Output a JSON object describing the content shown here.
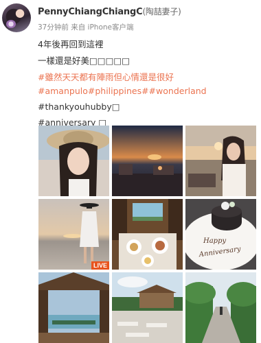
{
  "post": {
    "username": "PennyChiangChiangC",
    "remark": "(陶喆妻子)",
    "time": "37分钟前",
    "source": "来自 iPhone客户端",
    "lines": [
      {
        "text": "4年後再回到這裡",
        "style": "plain"
      },
      {
        "text": "一樣還是好美□□□□□",
        "style": "plain"
      },
      {
        "text": "#雖然天天都有陣雨但心情還是很好",
        "style": "tag"
      },
      {
        "text": "#amanpulo#philippines##wonderland",
        "style": "tag"
      },
      {
        "text": "#thankyouhubby□",
        "style": "plain"
      },
      {
        "text": "#anniversary □",
        "style": "plain"
      }
    ]
  },
  "photos": [
    {
      "name": "photo-woman-hat",
      "scene": "woman in straw hat"
    },
    {
      "name": "photo-sunset-deck",
      "scene": "sunset over sea deck"
    },
    {
      "name": "photo-woman-pool",
      "scene": "woman by the sea"
    },
    {
      "name": "photo-beach-sunset",
      "scene": "woman on beach at sunset",
      "live_label": "LIVE"
    },
    {
      "name": "photo-breakfast",
      "scene": "breakfast table"
    },
    {
      "name": "photo-cake",
      "scene": "anniversary cake",
      "plate_text_1": "Happy",
      "plate_text_2": "Anniversary"
    },
    {
      "name": "photo-pavilion",
      "scene": "wooden pavilion over water"
    },
    {
      "name": "photo-resort-lounge",
      "scene": "resort lounge chairs"
    },
    {
      "name": "photo-path",
      "scene": "garden path"
    }
  ]
}
